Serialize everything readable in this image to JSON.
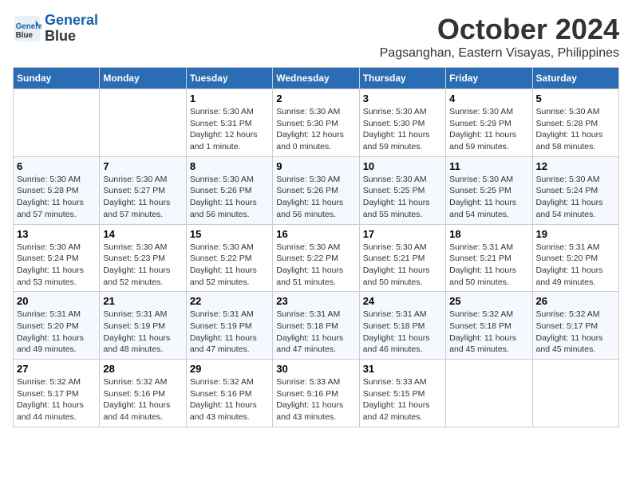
{
  "header": {
    "logo_line1": "General",
    "logo_line2": "Blue",
    "month": "October 2024",
    "location": "Pagsanghan, Eastern Visayas, Philippines"
  },
  "weekdays": [
    "Sunday",
    "Monday",
    "Tuesday",
    "Wednesday",
    "Thursday",
    "Friday",
    "Saturday"
  ],
  "weeks": [
    [
      {
        "day": "",
        "sunrise": "",
        "sunset": "",
        "daylight": ""
      },
      {
        "day": "",
        "sunrise": "",
        "sunset": "",
        "daylight": ""
      },
      {
        "day": "1",
        "sunrise": "Sunrise: 5:30 AM",
        "sunset": "Sunset: 5:31 PM",
        "daylight": "Daylight: 12 hours and 1 minute."
      },
      {
        "day": "2",
        "sunrise": "Sunrise: 5:30 AM",
        "sunset": "Sunset: 5:30 PM",
        "daylight": "Daylight: 12 hours and 0 minutes."
      },
      {
        "day": "3",
        "sunrise": "Sunrise: 5:30 AM",
        "sunset": "Sunset: 5:30 PM",
        "daylight": "Daylight: 11 hours and 59 minutes."
      },
      {
        "day": "4",
        "sunrise": "Sunrise: 5:30 AM",
        "sunset": "Sunset: 5:29 PM",
        "daylight": "Daylight: 11 hours and 59 minutes."
      },
      {
        "day": "5",
        "sunrise": "Sunrise: 5:30 AM",
        "sunset": "Sunset: 5:28 PM",
        "daylight": "Daylight: 11 hours and 58 minutes."
      }
    ],
    [
      {
        "day": "6",
        "sunrise": "Sunrise: 5:30 AM",
        "sunset": "Sunset: 5:28 PM",
        "daylight": "Daylight: 11 hours and 57 minutes."
      },
      {
        "day": "7",
        "sunrise": "Sunrise: 5:30 AM",
        "sunset": "Sunset: 5:27 PM",
        "daylight": "Daylight: 11 hours and 57 minutes."
      },
      {
        "day": "8",
        "sunrise": "Sunrise: 5:30 AM",
        "sunset": "Sunset: 5:26 PM",
        "daylight": "Daylight: 11 hours and 56 minutes."
      },
      {
        "day": "9",
        "sunrise": "Sunrise: 5:30 AM",
        "sunset": "Sunset: 5:26 PM",
        "daylight": "Daylight: 11 hours and 56 minutes."
      },
      {
        "day": "10",
        "sunrise": "Sunrise: 5:30 AM",
        "sunset": "Sunset: 5:25 PM",
        "daylight": "Daylight: 11 hours and 55 minutes."
      },
      {
        "day": "11",
        "sunrise": "Sunrise: 5:30 AM",
        "sunset": "Sunset: 5:25 PM",
        "daylight": "Daylight: 11 hours and 54 minutes."
      },
      {
        "day": "12",
        "sunrise": "Sunrise: 5:30 AM",
        "sunset": "Sunset: 5:24 PM",
        "daylight": "Daylight: 11 hours and 54 minutes."
      }
    ],
    [
      {
        "day": "13",
        "sunrise": "Sunrise: 5:30 AM",
        "sunset": "Sunset: 5:24 PM",
        "daylight": "Daylight: 11 hours and 53 minutes."
      },
      {
        "day": "14",
        "sunrise": "Sunrise: 5:30 AM",
        "sunset": "Sunset: 5:23 PM",
        "daylight": "Daylight: 11 hours and 52 minutes."
      },
      {
        "day": "15",
        "sunrise": "Sunrise: 5:30 AM",
        "sunset": "Sunset: 5:22 PM",
        "daylight": "Daylight: 11 hours and 52 minutes."
      },
      {
        "day": "16",
        "sunrise": "Sunrise: 5:30 AM",
        "sunset": "Sunset: 5:22 PM",
        "daylight": "Daylight: 11 hours and 51 minutes."
      },
      {
        "day": "17",
        "sunrise": "Sunrise: 5:30 AM",
        "sunset": "Sunset: 5:21 PM",
        "daylight": "Daylight: 11 hours and 50 minutes."
      },
      {
        "day": "18",
        "sunrise": "Sunrise: 5:31 AM",
        "sunset": "Sunset: 5:21 PM",
        "daylight": "Daylight: 11 hours and 50 minutes."
      },
      {
        "day": "19",
        "sunrise": "Sunrise: 5:31 AM",
        "sunset": "Sunset: 5:20 PM",
        "daylight": "Daylight: 11 hours and 49 minutes."
      }
    ],
    [
      {
        "day": "20",
        "sunrise": "Sunrise: 5:31 AM",
        "sunset": "Sunset: 5:20 PM",
        "daylight": "Daylight: 11 hours and 49 minutes."
      },
      {
        "day": "21",
        "sunrise": "Sunrise: 5:31 AM",
        "sunset": "Sunset: 5:19 PM",
        "daylight": "Daylight: 11 hours and 48 minutes."
      },
      {
        "day": "22",
        "sunrise": "Sunrise: 5:31 AM",
        "sunset": "Sunset: 5:19 PM",
        "daylight": "Daylight: 11 hours and 47 minutes."
      },
      {
        "day": "23",
        "sunrise": "Sunrise: 5:31 AM",
        "sunset": "Sunset: 5:18 PM",
        "daylight": "Daylight: 11 hours and 47 minutes."
      },
      {
        "day": "24",
        "sunrise": "Sunrise: 5:31 AM",
        "sunset": "Sunset: 5:18 PM",
        "daylight": "Daylight: 11 hours and 46 minutes."
      },
      {
        "day": "25",
        "sunrise": "Sunrise: 5:32 AM",
        "sunset": "Sunset: 5:18 PM",
        "daylight": "Daylight: 11 hours and 45 minutes."
      },
      {
        "day": "26",
        "sunrise": "Sunrise: 5:32 AM",
        "sunset": "Sunset: 5:17 PM",
        "daylight": "Daylight: 11 hours and 45 minutes."
      }
    ],
    [
      {
        "day": "27",
        "sunrise": "Sunrise: 5:32 AM",
        "sunset": "Sunset: 5:17 PM",
        "daylight": "Daylight: 11 hours and 44 minutes."
      },
      {
        "day": "28",
        "sunrise": "Sunrise: 5:32 AM",
        "sunset": "Sunset: 5:16 PM",
        "daylight": "Daylight: 11 hours and 44 minutes."
      },
      {
        "day": "29",
        "sunrise": "Sunrise: 5:32 AM",
        "sunset": "Sunset: 5:16 PM",
        "daylight": "Daylight: 11 hours and 43 minutes."
      },
      {
        "day": "30",
        "sunrise": "Sunrise: 5:33 AM",
        "sunset": "Sunset: 5:16 PM",
        "daylight": "Daylight: 11 hours and 43 minutes."
      },
      {
        "day": "31",
        "sunrise": "Sunrise: 5:33 AM",
        "sunset": "Sunset: 5:15 PM",
        "daylight": "Daylight: 11 hours and 42 minutes."
      },
      {
        "day": "",
        "sunrise": "",
        "sunset": "",
        "daylight": ""
      },
      {
        "day": "",
        "sunrise": "",
        "sunset": "",
        "daylight": ""
      }
    ]
  ]
}
